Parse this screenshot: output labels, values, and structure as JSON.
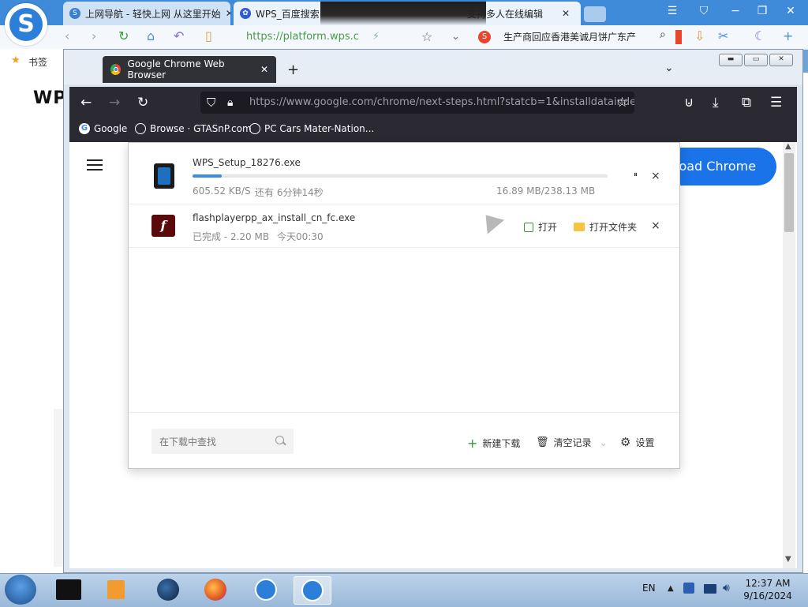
{
  "outer_browser": {
    "tabs": [
      {
        "label": "上网导航 - 轻快上网 从这里开始",
        "icon": "sogou-tab-icon"
      },
      {
        "label": "WPS_百度搜索",
        "icon": "baidu-paw-icon",
        "trailing_label": "支持多人在线编辑"
      }
    ],
    "address": "https://platform.wps.c",
    "search_hint": "生产商回应香港美诚月饼广东产",
    "bookmark_label": "书签",
    "page_logo": "WPS"
  },
  "inner_browser": {
    "tab_label": "Google Chrome Web Browser",
    "url": "https://www.google.com/chrome/next-steps.html?statcb=1&installdataindex",
    "bookmarks": [
      {
        "label": "Google"
      },
      {
        "label": "Browse · GTASnP.com"
      },
      {
        "label": "PC Cars Mater-Nation..."
      }
    ],
    "download_chrome_button": "load Chrome"
  },
  "download_manager": {
    "items": [
      {
        "file_name": "WPS_Setup_18276.exe",
        "speed": "605.52 KB/S",
        "remaining": "还有 6分钟14秒",
        "size_progress": "16.89 MB/238.13 MB",
        "progress_fraction": 0.07,
        "pause_label": "⏸",
        "close_label": "×"
      },
      {
        "file_name": "flashplayerpp_ax_install_cn_fc.exe",
        "status": "已完成 - 2.20 MB",
        "time": "今天00:30",
        "open_label": "打开",
        "open_folder_label": "打开文件夹",
        "close_label": "×"
      }
    ],
    "footer": {
      "search_placeholder": "在下载中查找",
      "new_download_label": "新建下载",
      "clear_records_label": "清空记录",
      "settings_label": "设置"
    }
  },
  "taskbar": {
    "language": "EN",
    "time": "12:37 AM",
    "date": "9/16/2024"
  }
}
